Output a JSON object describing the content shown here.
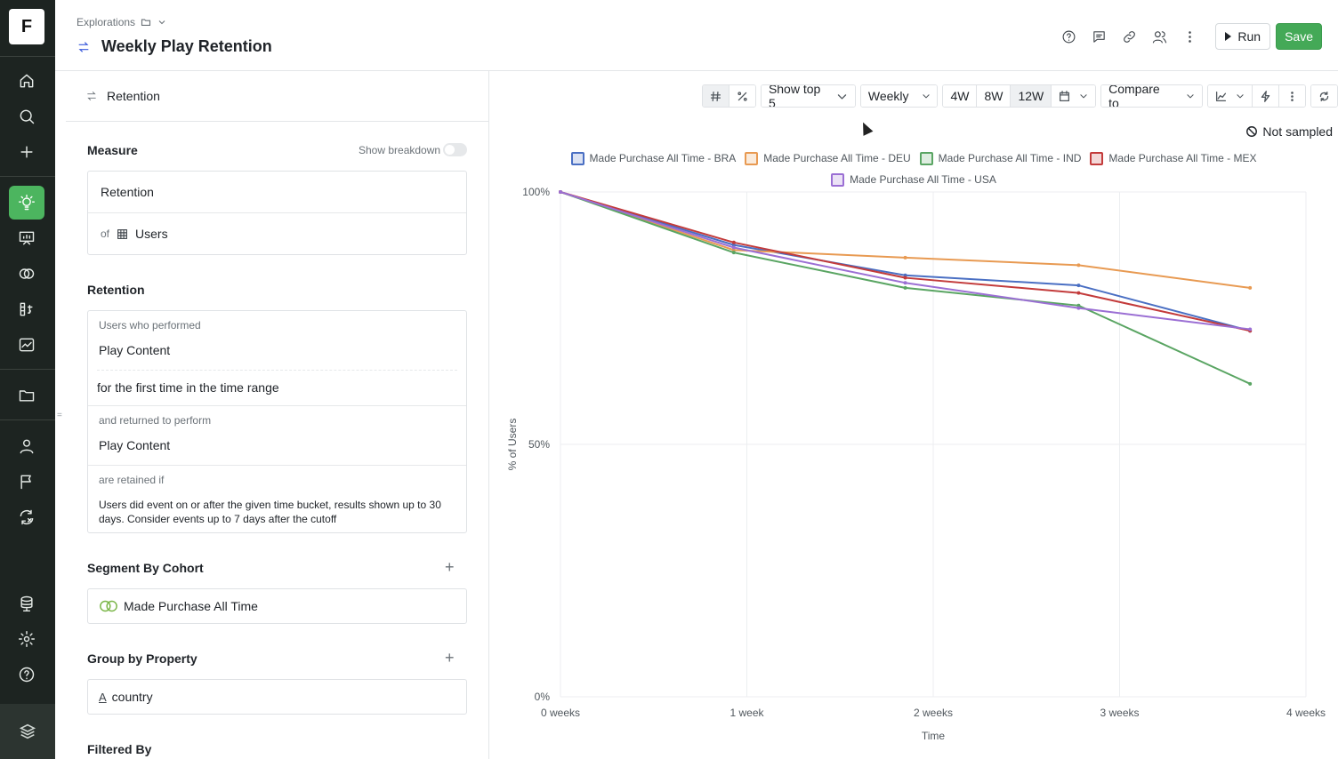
{
  "rail": {
    "logo": "F",
    "icons": [
      "home-icon",
      "search-icon",
      "plus-icon",
      "lightbulb-icon",
      "presentation-icon",
      "cohort-icon",
      "formula-icon",
      "chart-icon",
      "folder-icon",
      "user-icon",
      "flag-icon",
      "experiment-icon",
      "database-icon",
      "gear-icon",
      "help-icon",
      "stack-icon"
    ]
  },
  "header": {
    "breadcrumb": "Explorations",
    "title": "Weekly Play Retention",
    "run_label": "Run",
    "save_label": "Save"
  },
  "panel": {
    "head_label": "Retention",
    "measure": {
      "title": "Measure",
      "show_breakdown": "Show breakdown",
      "metric": "Retention",
      "of_label": "of",
      "entity": "Users"
    },
    "retention": {
      "title": "Retention",
      "performed_label": "Users who performed",
      "performed_event": "Play Content",
      "first_time": "for the first time in the time range",
      "returned_label": "and returned to perform",
      "returned_event": "Play Content",
      "retained_label": "are retained if",
      "retained_desc": "Users did event on or after the given time bucket, results shown up to 30 days. Consider events up to 7 days after the cutoff"
    },
    "segment": {
      "title": "Segment By Cohort",
      "cohort": "Made Purchase All Time"
    },
    "group": {
      "title": "Group by Property",
      "property": "country"
    },
    "filter": {
      "title": "Filtered By"
    }
  },
  "toolbar": {
    "show_top": "Show top 5",
    "interval": "Weekly",
    "ranges": [
      "4W",
      "8W",
      "12W"
    ],
    "selected_range": "12W",
    "compare": "Compare to"
  },
  "not_sampled": "Not sampled",
  "chart_data": {
    "type": "line",
    "xlabel": "Time",
    "ylabel": "% of Users",
    "x_ticks": [
      "0 weeks",
      "1 week",
      "2 weeks",
      "3 weeks",
      "4 weeks"
    ],
    "y_ticks": [
      "0%",
      "50%",
      "100%"
    ],
    "ylim": [
      0,
      100
    ],
    "xlim": [
      0,
      4
    ],
    "grid": true,
    "legend": "top",
    "x": [
      0,
      0.93,
      1.85,
      2.78,
      3.7
    ],
    "series": [
      {
        "name": "Made Purchase All Time - BRA",
        "color": "#4a6fc3",
        "values": [
          100,
          89.5,
          83.5,
          81.5,
          72.5
        ]
      },
      {
        "name": "Made Purchase All Time - DEU",
        "color": "#e89a52",
        "values": [
          100,
          88.5,
          87,
          85.5,
          81
        ]
      },
      {
        "name": "Made Purchase All Time - IND",
        "color": "#5aa563",
        "values": [
          100,
          88,
          81,
          77.5,
          62
        ]
      },
      {
        "name": "Made Purchase All Time - MEX",
        "color": "#c33b3b",
        "values": [
          100,
          90,
          83,
          80,
          72.5
        ]
      },
      {
        "name": "Made Purchase All Time - USA",
        "color": "#9b6fd4",
        "values": [
          100,
          89,
          82,
          77,
          72.8
        ]
      }
    ]
  }
}
